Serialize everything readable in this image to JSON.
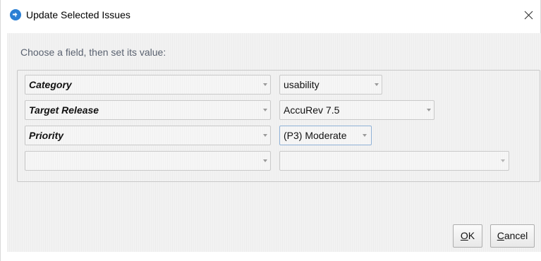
{
  "window": {
    "title": "Update Selected Issues",
    "close_icon": "close-icon"
  },
  "instruction": "Choose a field, then set its value:",
  "rows": [
    {
      "field": "Category",
      "value": "usability",
      "value_focused": false
    },
    {
      "field": "Target Release",
      "value": "AccuRev 7.5",
      "value_focused": false
    },
    {
      "field": "Priority",
      "value": "(P3) Moderate",
      "value_focused": true
    },
    {
      "field": "",
      "value": "",
      "value_focused": false
    }
  ],
  "buttons": {
    "ok": {
      "mnemonic": "O",
      "rest": "K"
    },
    "cancel": {
      "mnemonic": "C",
      "rest": "ancel"
    }
  },
  "colors": {
    "app_icon": "#2a7fd4",
    "focus_border": "#8fb1d6"
  }
}
